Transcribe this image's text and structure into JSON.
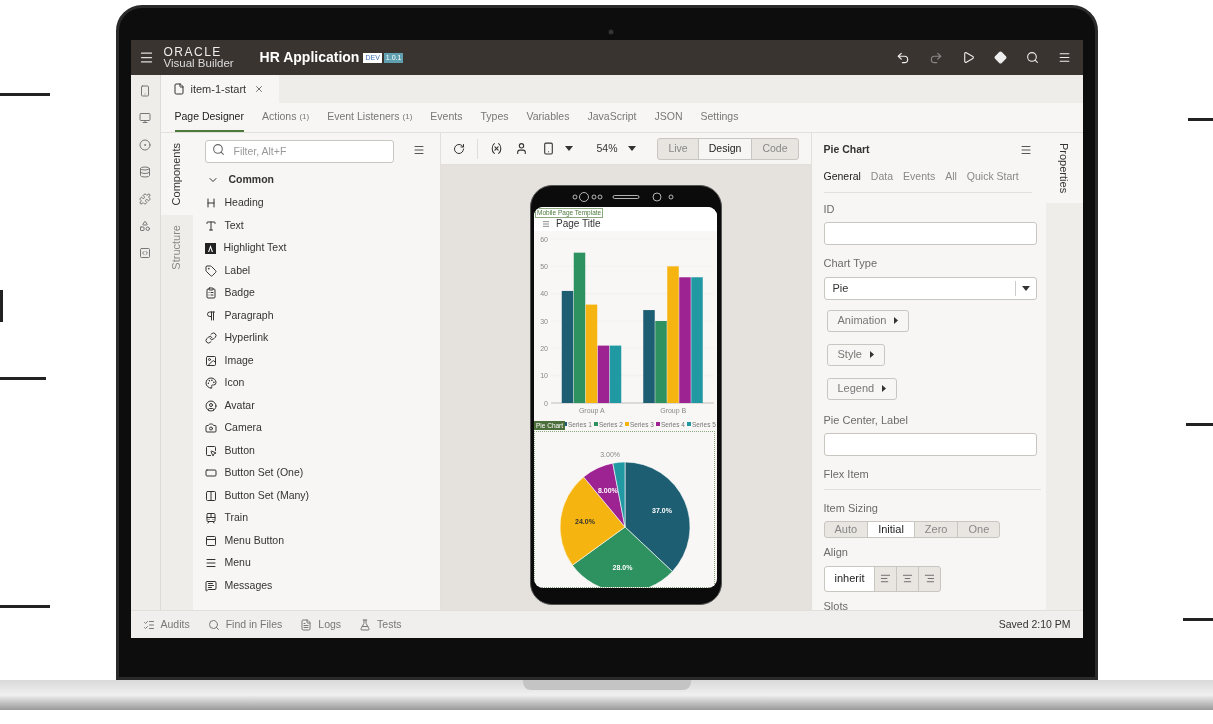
{
  "header": {
    "brand": "ORACLE",
    "product": "Visual Builder",
    "app_title": "HR Application",
    "badges": [
      {
        "kind": "env",
        "label": "DEV"
      },
      {
        "kind": "version",
        "label": "1.0.1"
      }
    ]
  },
  "file_tabs": [
    {
      "label": "item-1-start",
      "selected": true
    }
  ],
  "designer_tabs": [
    {
      "label": "Page Designer",
      "selected": true
    },
    {
      "label": "Actions",
      "count": "(1)",
      "selected": false
    },
    {
      "label": "Event Listeners",
      "count": "(1)",
      "selected": false
    },
    {
      "label": "Events",
      "selected": false
    },
    {
      "label": "Types",
      "selected": false
    },
    {
      "label": "Variables",
      "selected": false
    },
    {
      "label": "JavaScript",
      "selected": false
    },
    {
      "label": "JSON",
      "selected": false
    },
    {
      "label": "Settings",
      "selected": false
    }
  ],
  "side_tabs": [
    {
      "label": "Components",
      "selected": true
    },
    {
      "label": "Structure",
      "selected": false
    }
  ],
  "components": {
    "filter_placeholder": "Filter, Alt+F",
    "group": {
      "label": "Common",
      "expanded": true,
      "items": [
        {
          "label": "Heading"
        },
        {
          "label": "Text"
        },
        {
          "label": "Highlight Text"
        },
        {
          "label": "Label"
        },
        {
          "label": "Badge"
        },
        {
          "label": "Paragraph"
        },
        {
          "label": "Hyperlink"
        },
        {
          "label": "Image"
        },
        {
          "label": "Icon"
        },
        {
          "label": "Avatar"
        },
        {
          "label": "Camera"
        },
        {
          "label": "Button"
        },
        {
          "label": "Button Set (One)"
        },
        {
          "label": "Button Set (Many)"
        },
        {
          "label": "Train"
        },
        {
          "label": "Menu Button"
        },
        {
          "label": "Menu"
        },
        {
          "label": "Messages"
        }
      ]
    }
  },
  "canvas": {
    "zoom": "54%",
    "modes": [
      {
        "label": "Live",
        "selected": false
      },
      {
        "label": "Design",
        "selected": true
      },
      {
        "label": "Code",
        "selected": false
      }
    ],
    "phone": {
      "template_label": "Mobile Page Template",
      "page_title": "Page Title",
      "selection_tag": "Pie Chart",
      "bar_chart": {
        "chart_data": {
          "type": "bar",
          "legend": "bottom",
          "categories": [
            "Group A",
            "Group B"
          ],
          "ylim": [
            0,
            60
          ],
          "yticks": [
            0,
            10,
            20,
            30,
            40,
            50,
            60
          ],
          "series": [
            {
              "name": "Series 1",
              "color": "#1d5e72",
              "values": [
                41,
                34
              ]
            },
            {
              "name": "Series 2",
              "color": "#2e9160",
              "values": [
                55,
                30
              ]
            },
            {
              "name": "Series 3",
              "color": "#f5b40f",
              "values": [
                36,
                50
              ]
            },
            {
              "name": "Series 4",
              "color": "#9c2391",
              "values": [
                21,
                46
              ]
            },
            {
              "name": "Series 5",
              "color": "#2199a2",
              "values": [
                21,
                46
              ]
            }
          ]
        }
      },
      "pie_chart": {
        "chart_data": {
          "type": "pie",
          "values": [
            37,
            28,
            24,
            8,
            3
          ],
          "colors": [
            "#1d5e72",
            "#2e9160",
            "#f5b40f",
            "#9c2391",
            "#2199a2"
          ],
          "value_labels": [
            "37.0%",
            "28.0%",
            "24.0%",
            "8.00%",
            "3.00%"
          ]
        }
      }
    }
  },
  "properties": {
    "title": "Pie Chart",
    "tabs": [
      {
        "label": "General",
        "selected": true
      },
      {
        "label": "Data",
        "selected": false
      },
      {
        "label": "Events",
        "selected": false
      },
      {
        "label": "All",
        "selected": false
      },
      {
        "label": "Quick Start",
        "selected": false
      }
    ],
    "fields": [
      {
        "kind": "input",
        "label": "ID"
      },
      {
        "kind": "select",
        "label": "Chart Type",
        "value": "Pie"
      },
      {
        "kind": "expander",
        "label": "Animation"
      },
      {
        "kind": "expander",
        "label": "Style"
      },
      {
        "kind": "expander",
        "label": "Legend"
      },
      {
        "kind": "input",
        "label": "Pie Center, Label"
      },
      {
        "kind": "section",
        "label": "Flex Item"
      },
      {
        "kind": "segmented",
        "label": "Item Sizing",
        "options": [
          {
            "kind": "text",
            "label": "Auto",
            "selected": false
          },
          {
            "kind": "text",
            "label": "Initial",
            "selected": true
          },
          {
            "kind": "text",
            "label": "Zero",
            "selected": false
          },
          {
            "kind": "text",
            "label": "One",
            "selected": false
          }
        ]
      },
      {
        "kind": "segmented",
        "label": "Align",
        "options": [
          {
            "kind": "text",
            "label": "inherit",
            "selected": true
          },
          {
            "kind": "start",
            "selected": false
          },
          {
            "kind": "center",
            "selected": false
          },
          {
            "kind": "end",
            "selected": false
          }
        ]
      },
      {
        "kind": "heading",
        "label": "Slots"
      }
    ]
  },
  "properties_tab": {
    "label": "Properties",
    "selected": true
  },
  "status_bar": {
    "tools": [
      {
        "kind": "audits",
        "label": "Audits"
      },
      {
        "kind": "find",
        "label": "Find in Files"
      },
      {
        "kind": "logs",
        "label": "Logs"
      },
      {
        "kind": "tests",
        "label": "Tests"
      }
    ],
    "saved": "Saved 2:10 PM"
  }
}
